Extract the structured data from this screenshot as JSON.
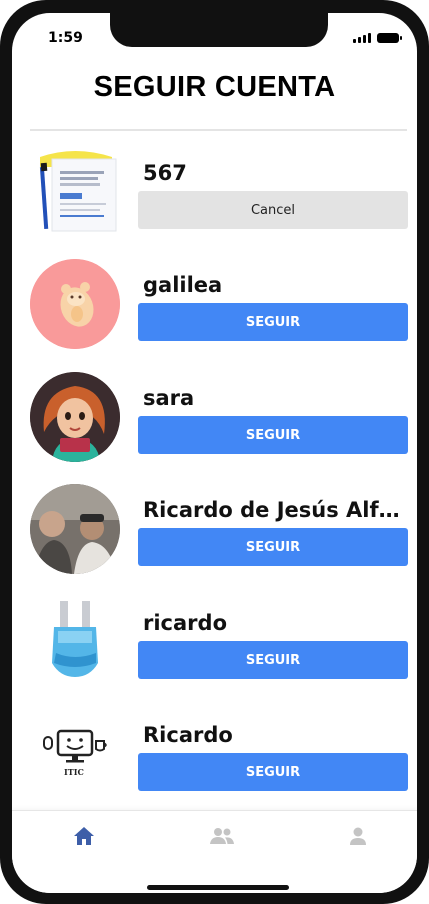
{
  "status_bar": {
    "time": "1:59"
  },
  "header": {
    "title": "SEGUIR CUENTA"
  },
  "accounts": [
    {
      "name": "567",
      "action": "Cancel",
      "avatar": "document-photo"
    },
    {
      "name": "galilea",
      "action": "SEGUIR",
      "avatar": "cartoon-hamster"
    },
    {
      "name": "sara",
      "action": "SEGUIR",
      "avatar": "cartoon-girl"
    },
    {
      "name": "Ricardo de Jesús Alfa...",
      "action": "SEGUIR",
      "avatar": "group-photo"
    },
    {
      "name": "ricardo",
      "action": "SEGUIR",
      "avatar": "blue-fuse"
    },
    {
      "name": "Ricardo",
      "action": "SEGUIR",
      "avatar": "computer-logo",
      "logo_text": "ITIC"
    }
  ],
  "tab_bar": {
    "tabs": [
      {
        "icon": "home-icon",
        "active": true
      },
      {
        "icon": "people-icon",
        "active": false
      },
      {
        "icon": "person-icon",
        "active": false
      }
    ]
  },
  "colors": {
    "primary_button": "#4287f5",
    "cancel_button": "#e3e3e3",
    "active_tab": "#3d5ea8",
    "inactive_tab": "#c4c4c4"
  }
}
